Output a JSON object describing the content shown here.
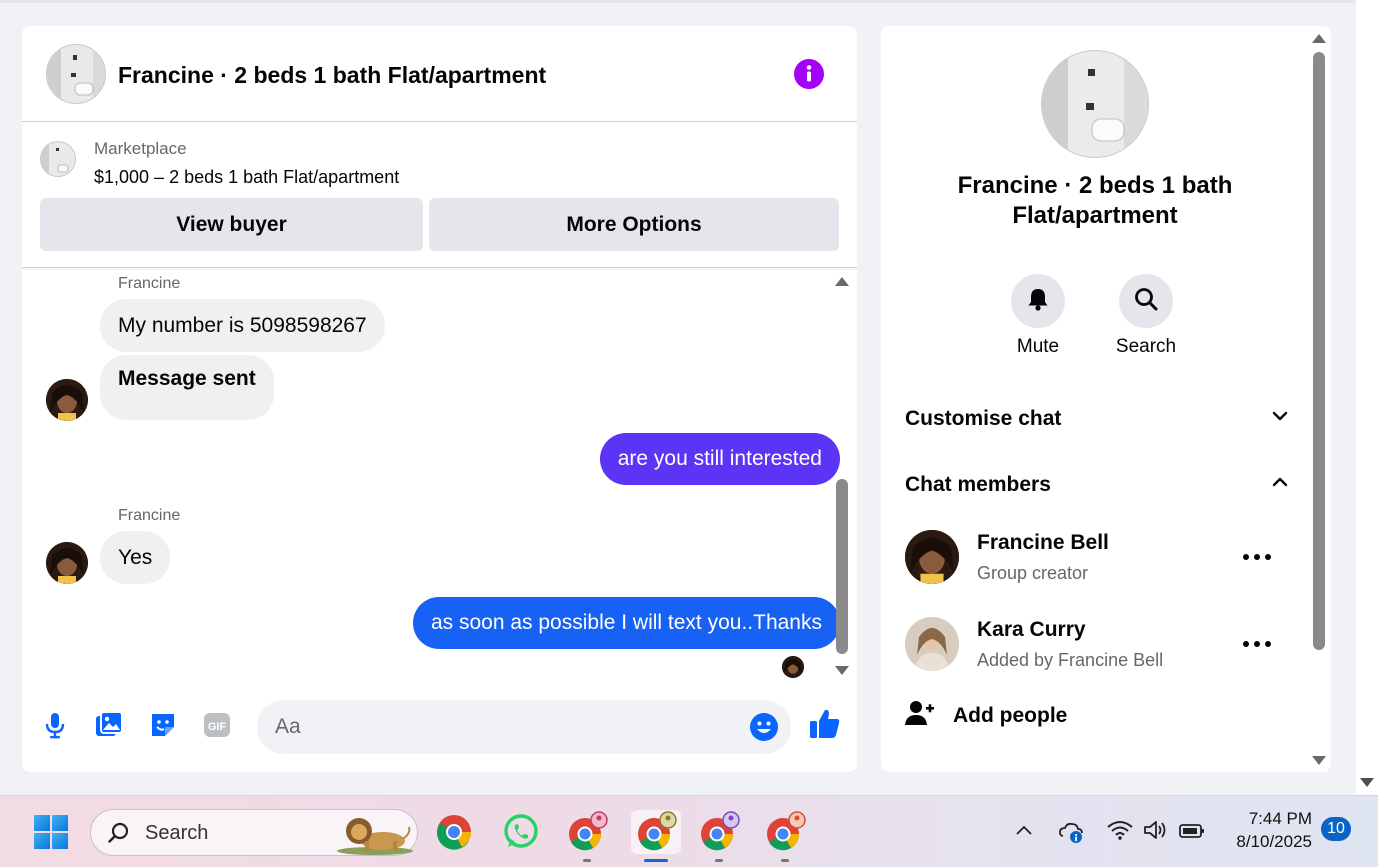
{
  "chat": {
    "title": "Francine · 2 beds 1 bath Flat/apartment",
    "marketplace": {
      "label": "Marketplace",
      "listing": "$1,000 – 2 beds 1 bath Flat/apartment",
      "view_buyer": "View buyer",
      "more_options": "More Options"
    },
    "messages": [
      {
        "sender": "Francine",
        "text": "My number is 5098598267",
        "direction": "incoming"
      },
      {
        "text": "Message sent",
        "direction": "incoming"
      },
      {
        "text": "are you still interested",
        "direction": "outgoing"
      },
      {
        "sender": "Francine",
        "text": "Yes",
        "direction": "incoming"
      },
      {
        "text": "as soon as possible I will text you..Thanks",
        "direction": "outgoing"
      }
    ],
    "composer": {
      "placeholder": "Aa",
      "icons": [
        "microphone-icon",
        "photo-icon",
        "sticker-icon",
        "gif-icon",
        "emoji-icon",
        "like-icon"
      ]
    },
    "colors": {
      "accent": "#a300f5",
      "outgoing_purple": "#5b34f5",
      "outgoing_blue": "#1761f5",
      "composer_icon": "#0866ff"
    }
  },
  "info": {
    "title": "Francine · 2 beds 1 bath Flat/apartment",
    "actions": [
      {
        "label": "Mute",
        "icon": "bell-icon"
      },
      {
        "label": "Search",
        "icon": "search-icon"
      }
    ],
    "sections": {
      "customise": "Customise chat",
      "members": "Chat members"
    },
    "members": [
      {
        "name": "Francine Bell",
        "role": "Group creator"
      },
      {
        "name": "Kara Curry",
        "role": "Added by Francine Bell"
      }
    ],
    "add_people": "Add people"
  },
  "taskbar": {
    "search_label": "Search",
    "apps": [
      "chrome-icon",
      "whatsapp-icon",
      "chrome-profile-icon",
      "chrome-profile-icon",
      "chrome-profile-icon",
      "chrome-profile-icon"
    ],
    "time": "7:44 PM",
    "date": "8/10/2025",
    "notifications": "10"
  }
}
